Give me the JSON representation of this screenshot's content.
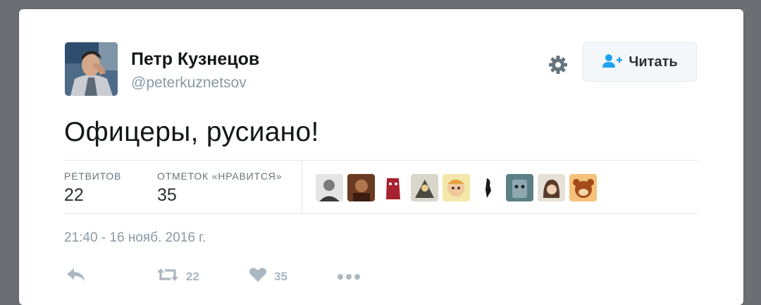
{
  "tweet": {
    "author_name": "Петр Кузнецов",
    "author_handle": "@peterkuznetsov",
    "text": "Офицеры, русиано!",
    "follow_label": "Читать",
    "retweets_label": "РЕТВИТОВ",
    "retweets_count": "22",
    "likes_label": "ОТМЕТОК «НРАВИТСЯ»",
    "likes_count": "35",
    "timestamp": "21:40 - 16 нояб. 2016 г.",
    "retweet_action_count": "22",
    "like_action_count": "35"
  },
  "likers": [
    {
      "name": "liker-avatar-1"
    },
    {
      "name": "liker-avatar-2"
    },
    {
      "name": "liker-avatar-3"
    },
    {
      "name": "liker-avatar-4"
    },
    {
      "name": "liker-avatar-5"
    },
    {
      "name": "liker-avatar-6"
    },
    {
      "name": "liker-avatar-7"
    },
    {
      "name": "liker-avatar-8"
    },
    {
      "name": "liker-avatar-9"
    }
  ],
  "icons": {
    "settings": "gear-icon",
    "follow": "add-user-icon",
    "reply": "reply-icon",
    "retweet": "retweet-icon",
    "like": "heart-icon",
    "more": "more-icon"
  },
  "colors": {
    "follow_icon": "#1da1f2",
    "muted": "#8899a6",
    "action": "#aab8c2"
  }
}
